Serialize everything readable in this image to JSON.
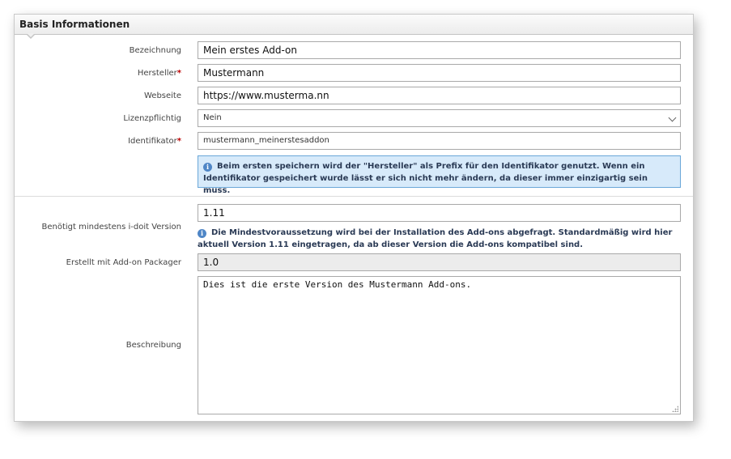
{
  "panel": {
    "title": "Basis Informationen"
  },
  "form": {
    "bezeichnung": {
      "label": "Bezeichnung",
      "value": "Mein erstes Add-on"
    },
    "hersteller": {
      "label": "Hersteller",
      "required_mark": "*",
      "value": "Mustermann"
    },
    "webseite": {
      "label": "Webseite",
      "value": "https://www.musterma.nn"
    },
    "lizenzpflichtig": {
      "label": "Lizenzpflichtig",
      "selected": "Nein"
    },
    "identifikator": {
      "label": "Identifikator",
      "required_mark": "*",
      "value": "mustermann_meinerstesaddon"
    },
    "identifikator_info": "Beim ersten speichern wird der \"Hersteller\" als Prefix für den Identifikator genutzt. Wenn ein Identifikator gespeichert wurde lässt er sich nicht mehr ändern, da dieser immer einzigartig sein muss.",
    "idoit_version": {
      "label": "Benötigt mindestens i-doit Version",
      "value": "1.11"
    },
    "idoit_version_hint": "Die Mindestvoraussetzung wird bei der Installation des Add-ons abgefragt. Standardmäßig wird hier aktuell Version 1.11 eingetragen, da ab dieser Version die Add-ons kompatibel sind.",
    "packager": {
      "label": "Erstellt mit Add-on Packager",
      "value": "1.0"
    },
    "beschreibung": {
      "label": "Beschreibung",
      "value": "Dies ist die erste Version des Mustermann Add-ons."
    }
  },
  "icons": {
    "info": "info-icon",
    "select_arrow": "chevron-down-icon",
    "resize": "resize-grip-icon"
  },
  "colors": {
    "required": "#bb0000",
    "info_background": "#d7eafa",
    "info_border": "#6aa7d8",
    "info_icon": "#4f86c6"
  }
}
